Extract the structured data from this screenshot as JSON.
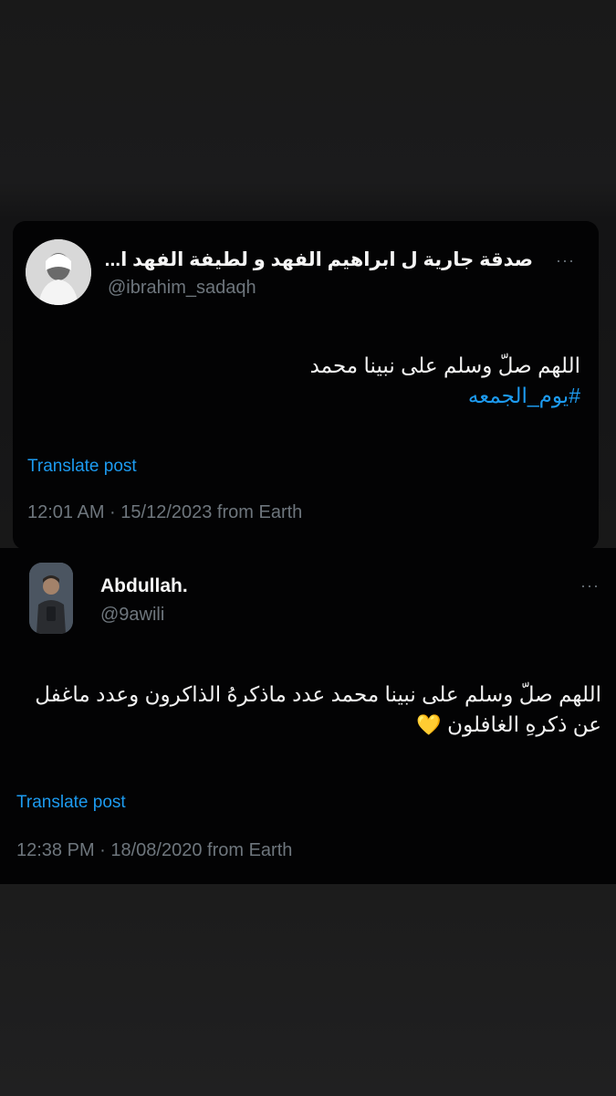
{
  "posts": [
    {
      "display_name": "صدقة جارية ل ابراهيم الفهد و لطيفة الفهد ا...",
      "handle": "@ibrahim_sadaqh",
      "text": "اللهم صلّ وسلم على نبينا محمد",
      "hashtag": "#يوم_الجمعه",
      "translate_label": "Translate post",
      "timestamp": "12:01 AM · 15/12/2023 from Earth",
      "more_label": "···"
    },
    {
      "display_name": "Abdullah.",
      "handle": "@9awili",
      "text": "اللهم صلّ وسلم على نبينا محمد عدد ماذكرهُ الذاكرون وعدد ماغفل عن ذكرهِ الغافلون",
      "emoji": "💛",
      "translate_label": "Translate post",
      "timestamp": "12:38 PM · 18/08/2020 from Earth",
      "more_label": "···"
    }
  ],
  "colors": {
    "background": "#1c1c1d",
    "card": "#030304",
    "link": "#1d9bf0",
    "muted": "#6e767d",
    "heart": "#ffc83d"
  },
  "icons": [
    "more-horizontal-icon",
    "yellow-heart-icon"
  ]
}
